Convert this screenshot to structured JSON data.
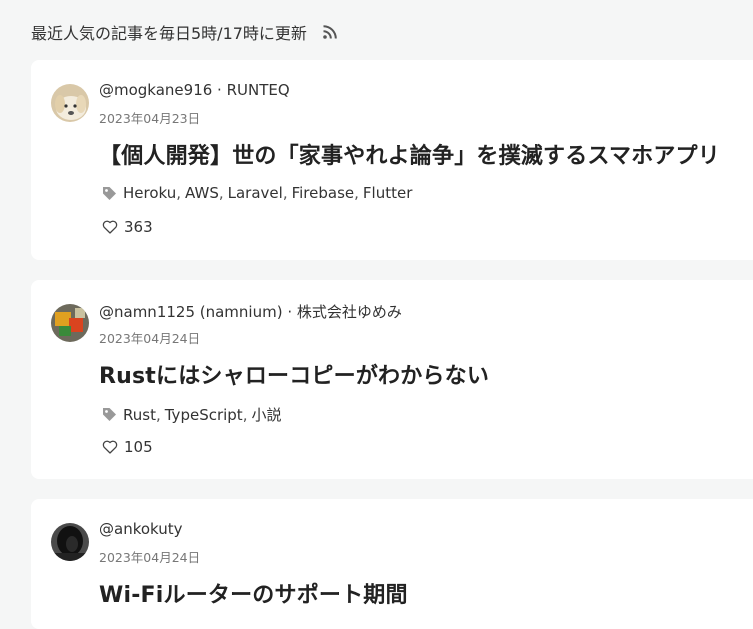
{
  "header": {
    "text": "最近人気の記事を毎日5時/17時に更新",
    "rss_icon": "rss-icon"
  },
  "colors": {
    "background": "#f5f6f6",
    "card": "#ffffff",
    "text": "#222222",
    "muted": "#777777",
    "icon": "#999999"
  },
  "articles": [
    {
      "author": "@mogkane916 · RUNTEQ",
      "date": "2023年04月23日",
      "title": "【個人開発】世の「家事やれよ論争」を撲滅するスマホアプリ",
      "tags": [
        "Heroku",
        "AWS",
        "Laravel",
        "Firebase",
        "Flutter"
      ],
      "likes": "363",
      "avatar_icon": "dog-avatar"
    },
    {
      "author": "@namn1125 (namnium) · 株式会社ゆめみ",
      "date": "2023年04月24日",
      "title": "Rustにはシャローコピーがわからない",
      "tags": [
        "Rust",
        "TypeScript",
        "小説"
      ],
      "likes": "105",
      "avatar_icon": "toy-avatar"
    },
    {
      "author": "@ankokuty",
      "date": "2023年04月24日",
      "title": "Wi-Fiルーターのサポート期間",
      "avatar_icon": "person-avatar"
    }
  ]
}
